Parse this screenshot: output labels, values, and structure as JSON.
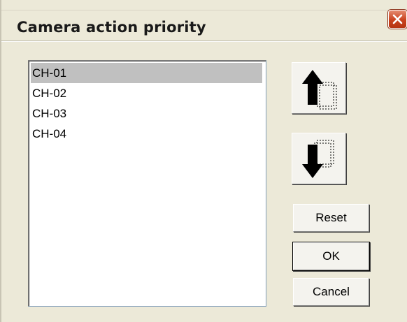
{
  "window": {
    "title": "Camera action priority"
  },
  "channel_list": {
    "items": [
      "CH-01",
      "CH-02",
      "CH-03",
      "CH-04"
    ],
    "selected": "CH-01"
  },
  "buttons": {
    "move_up_icon": "arrow-up-icon",
    "move_down_icon": "arrow-down-icon",
    "reset_label": "Reset",
    "ok_label": "OK",
    "cancel_label": "Cancel"
  },
  "colors": {
    "dialog_background": "#ece9d8",
    "selection_background": "#c0c0c0",
    "close_button": "#c9421e"
  }
}
